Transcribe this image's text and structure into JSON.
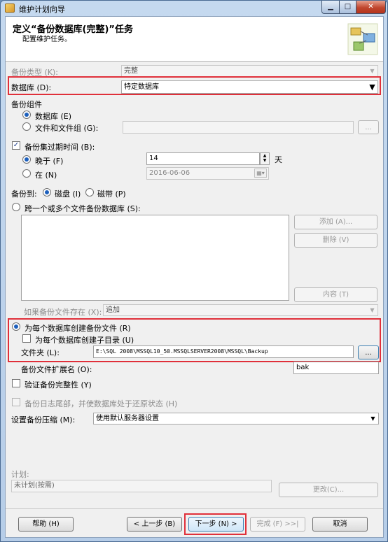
{
  "window": {
    "title": "维护计划向导",
    "minimize_glyph": "▁",
    "maximize_glyph": "□",
    "close_glyph": "✕"
  },
  "header": {
    "title": "定义“备份数据库(完整)”任务",
    "subtitle": "配置维护任务。"
  },
  "backup_type": {
    "label": "备份类型 (K):",
    "value": "完整"
  },
  "database": {
    "label": "数据库 (D):",
    "value": "特定数据库"
  },
  "backup_component": {
    "label": "备份组件",
    "database_option": "数据库 (E)",
    "files_option": "文件和文件组 (G):",
    "browse_label": "..."
  },
  "expiry": {
    "label": "备份集过期时间 (B):",
    "after_option": "晚于 (F)",
    "after_value": "14",
    "after_unit": "天",
    "on_option": "在 (N)",
    "on_value": "2016-06-06"
  },
  "backup_to": {
    "label": "备份到:",
    "disk": "磁盘 (I)",
    "tape": "磁带 (P)"
  },
  "span_files": {
    "label": "跨一个或多个文件备份数据库 (S):",
    "add": "添加 (A)...",
    "remove": "删除 (V)",
    "contents": "内容 (T)"
  },
  "if_exists": {
    "label": "如果备份文件存在 (X):",
    "value": "追加"
  },
  "per_db": {
    "create_file": "为每个数据库创建备份文件 (R)",
    "create_subdir": "为每个数据库创建子目录 (U)",
    "folder_label": "文件夹 (L):",
    "folder_value": "E:\\SQL 2008\\MSSQL10_50.MSSQLSERVER2008\\MSSQL\\Backup",
    "browse_label": "..."
  },
  "extension": {
    "label": "备份文件扩展名 (O):",
    "value": "bak"
  },
  "verify": {
    "label": "验证备份完整性 (Y)"
  },
  "tail_log": {
    "label": "备份日志尾部，并使数据库处于还原状态 (H)"
  },
  "compression": {
    "label": "设置备份压缩 (M):",
    "value": "使用默认服务器设置"
  },
  "schedule": {
    "label": "计划:",
    "value": "未计划(按需)",
    "change": "更改(C)..."
  },
  "footer": {
    "help": "帮助 (H)",
    "back": "< 上一步 (B)",
    "next": "下一步 (N) >",
    "finish": "完成 (F) >>|",
    "cancel": "取消"
  },
  "colors": {
    "highlight": "#e0303a",
    "accent": "#1c5fbc"
  }
}
